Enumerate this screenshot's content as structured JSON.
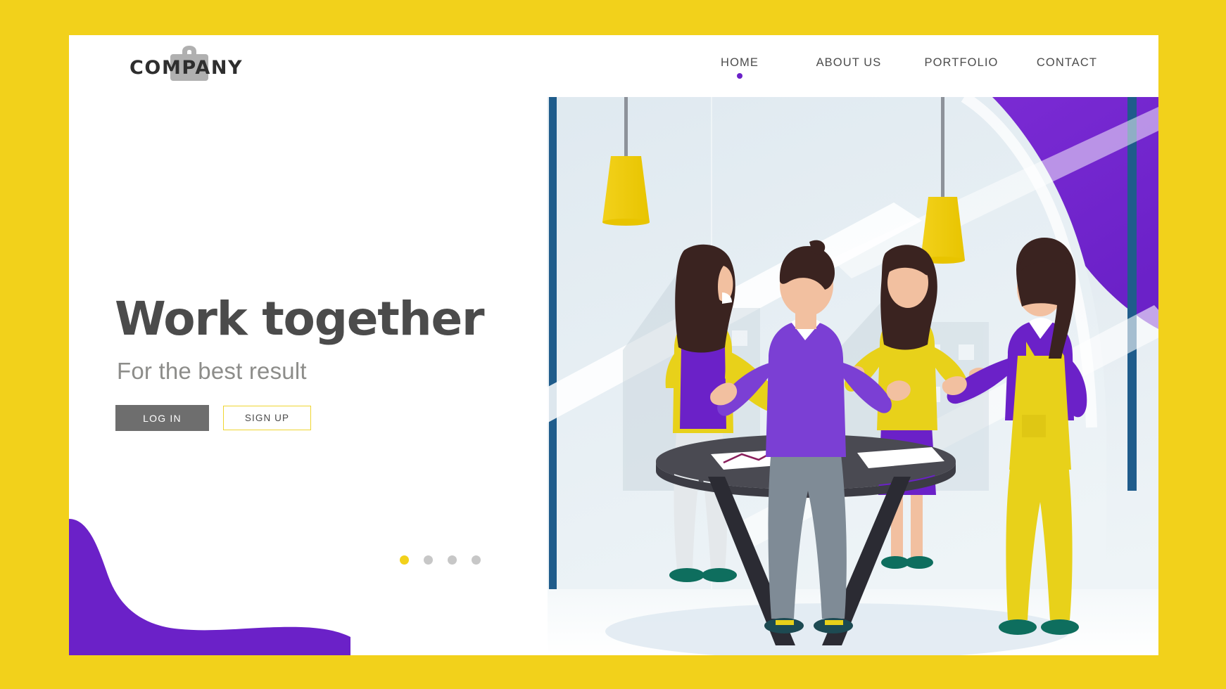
{
  "theme": {
    "page_background": "#F2D11B",
    "card_background": "#FFFFFF",
    "accent_yellow": "#F2D11B",
    "accent_purple": "#6B21C8",
    "accent_blue": "#1F5C8B",
    "text_dark": "#4B4B4B",
    "text_muted": "#8D8D8A",
    "button_gray": "#6E6E6E"
  },
  "header": {
    "brand_name": "COMPANY",
    "brand_icon": "briefcase-icon",
    "nav_items": [
      {
        "label": "HOME",
        "active": true
      },
      {
        "label": "ABOUT US",
        "active": false
      },
      {
        "label": "PORTFOLIO",
        "active": false
      },
      {
        "label": "CONTACT",
        "active": false
      }
    ]
  },
  "hero": {
    "title": "Work together",
    "subtitle": "For the best result",
    "buttons": {
      "login_label": "LOG IN",
      "signup_label": "SIGN UP"
    }
  },
  "carousel": {
    "slides": [
      {
        "active": true
      },
      {
        "active": false
      },
      {
        "active": false
      },
      {
        "active": false
      }
    ]
  },
  "illustration": {
    "scene": "office-team-meeting",
    "description": "Four business people standing around a round dark table with charts, in a bright office with large windows and two hanging pendant lamps",
    "elements": [
      {
        "name": "pendant-lamp-left",
        "color": "#F2D11B"
      },
      {
        "name": "pendant-lamp-right",
        "color": "#F2D11B"
      },
      {
        "name": "window-frame-left",
        "color": "#1F5C8B"
      },
      {
        "name": "window-frame-right",
        "color": "#1F5C8B"
      },
      {
        "name": "purple-corner-shape",
        "color": "#6B21C8"
      },
      {
        "name": "city-skyline-silhouette",
        "color": "#E2E8EC"
      },
      {
        "name": "meeting-table",
        "color": "#4A4A52"
      },
      {
        "name": "chart-document",
        "color": "#FFFFFF"
      }
    ],
    "people": [
      {
        "name": "person-left-woman",
        "top": "#E8D11A",
        "bottom": "#E6E9EC",
        "vest": "#6B21C8",
        "shoes": "#0E6E5E"
      },
      {
        "name": "person-center-man",
        "top": "#7B3FD4",
        "bottom": "#7F8B96",
        "shoes": "#1D4A52"
      },
      {
        "name": "person-back-woman",
        "top": "#E8D11A",
        "bottom": "#6B21C8",
        "shoes": "#0E6E5E"
      },
      {
        "name": "person-right-woman",
        "top": "#6B21C8",
        "bottom": "#E8D11A",
        "shoes": "#0E6E5E"
      }
    ]
  }
}
